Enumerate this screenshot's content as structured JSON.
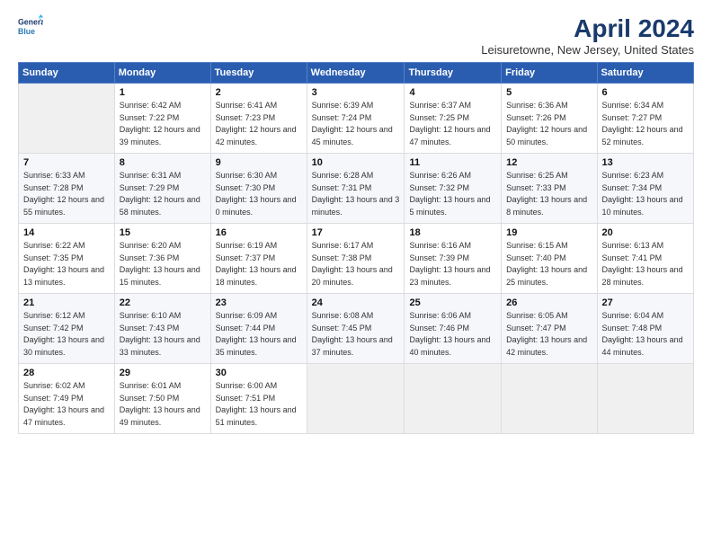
{
  "header": {
    "logo_line1": "General",
    "logo_line2": "Blue",
    "title": "April 2024",
    "subtitle": "Leisuretowne, New Jersey, United States"
  },
  "days_of_week": [
    "Sunday",
    "Monday",
    "Tuesday",
    "Wednesday",
    "Thursday",
    "Friday",
    "Saturday"
  ],
  "weeks": [
    [
      {
        "day": "",
        "empty": true
      },
      {
        "day": "1",
        "sunrise": "6:42 AM",
        "sunset": "7:22 PM",
        "daylight": "12 hours and 39 minutes."
      },
      {
        "day": "2",
        "sunrise": "6:41 AM",
        "sunset": "7:23 PM",
        "daylight": "12 hours and 42 minutes."
      },
      {
        "day": "3",
        "sunrise": "6:39 AM",
        "sunset": "7:24 PM",
        "daylight": "12 hours and 45 minutes."
      },
      {
        "day": "4",
        "sunrise": "6:37 AM",
        "sunset": "7:25 PM",
        "daylight": "12 hours and 47 minutes."
      },
      {
        "day": "5",
        "sunrise": "6:36 AM",
        "sunset": "7:26 PM",
        "daylight": "12 hours and 50 minutes."
      },
      {
        "day": "6",
        "sunrise": "6:34 AM",
        "sunset": "7:27 PM",
        "daylight": "12 hours and 52 minutes."
      }
    ],
    [
      {
        "day": "7",
        "sunrise": "6:33 AM",
        "sunset": "7:28 PM",
        "daylight": "12 hours and 55 minutes."
      },
      {
        "day": "8",
        "sunrise": "6:31 AM",
        "sunset": "7:29 PM",
        "daylight": "12 hours and 58 minutes."
      },
      {
        "day": "9",
        "sunrise": "6:30 AM",
        "sunset": "7:30 PM",
        "daylight": "13 hours and 0 minutes."
      },
      {
        "day": "10",
        "sunrise": "6:28 AM",
        "sunset": "7:31 PM",
        "daylight": "13 hours and 3 minutes."
      },
      {
        "day": "11",
        "sunrise": "6:26 AM",
        "sunset": "7:32 PM",
        "daylight": "13 hours and 5 minutes."
      },
      {
        "day": "12",
        "sunrise": "6:25 AM",
        "sunset": "7:33 PM",
        "daylight": "13 hours and 8 minutes."
      },
      {
        "day": "13",
        "sunrise": "6:23 AM",
        "sunset": "7:34 PM",
        "daylight": "13 hours and 10 minutes."
      }
    ],
    [
      {
        "day": "14",
        "sunrise": "6:22 AM",
        "sunset": "7:35 PM",
        "daylight": "13 hours and 13 minutes."
      },
      {
        "day": "15",
        "sunrise": "6:20 AM",
        "sunset": "7:36 PM",
        "daylight": "13 hours and 15 minutes."
      },
      {
        "day": "16",
        "sunrise": "6:19 AM",
        "sunset": "7:37 PM",
        "daylight": "13 hours and 18 minutes."
      },
      {
        "day": "17",
        "sunrise": "6:17 AM",
        "sunset": "7:38 PM",
        "daylight": "13 hours and 20 minutes."
      },
      {
        "day": "18",
        "sunrise": "6:16 AM",
        "sunset": "7:39 PM",
        "daylight": "13 hours and 23 minutes."
      },
      {
        "day": "19",
        "sunrise": "6:15 AM",
        "sunset": "7:40 PM",
        "daylight": "13 hours and 25 minutes."
      },
      {
        "day": "20",
        "sunrise": "6:13 AM",
        "sunset": "7:41 PM",
        "daylight": "13 hours and 28 minutes."
      }
    ],
    [
      {
        "day": "21",
        "sunrise": "6:12 AM",
        "sunset": "7:42 PM",
        "daylight": "13 hours and 30 minutes."
      },
      {
        "day": "22",
        "sunrise": "6:10 AM",
        "sunset": "7:43 PM",
        "daylight": "13 hours and 33 minutes."
      },
      {
        "day": "23",
        "sunrise": "6:09 AM",
        "sunset": "7:44 PM",
        "daylight": "13 hours and 35 minutes."
      },
      {
        "day": "24",
        "sunrise": "6:08 AM",
        "sunset": "7:45 PM",
        "daylight": "13 hours and 37 minutes."
      },
      {
        "day": "25",
        "sunrise": "6:06 AM",
        "sunset": "7:46 PM",
        "daylight": "13 hours and 40 minutes."
      },
      {
        "day": "26",
        "sunrise": "6:05 AM",
        "sunset": "7:47 PM",
        "daylight": "13 hours and 42 minutes."
      },
      {
        "day": "27",
        "sunrise": "6:04 AM",
        "sunset": "7:48 PM",
        "daylight": "13 hours and 44 minutes."
      }
    ],
    [
      {
        "day": "28",
        "sunrise": "6:02 AM",
        "sunset": "7:49 PM",
        "daylight": "13 hours and 47 minutes."
      },
      {
        "day": "29",
        "sunrise": "6:01 AM",
        "sunset": "7:50 PM",
        "daylight": "13 hours and 49 minutes."
      },
      {
        "day": "30",
        "sunrise": "6:00 AM",
        "sunset": "7:51 PM",
        "daylight": "13 hours and 51 minutes."
      },
      {
        "day": "",
        "empty": true
      },
      {
        "day": "",
        "empty": true
      },
      {
        "day": "",
        "empty": true
      },
      {
        "day": "",
        "empty": true
      }
    ]
  ],
  "labels": {
    "sunrise": "Sunrise:",
    "sunset": "Sunset:",
    "daylight": "Daylight hours"
  }
}
